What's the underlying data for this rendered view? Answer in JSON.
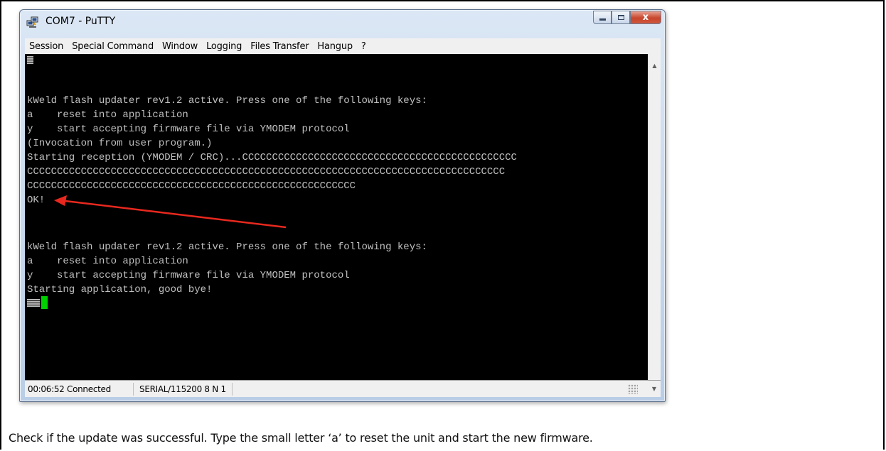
{
  "window": {
    "title": "COM7 - PuTTY",
    "controls": {
      "minimize_icon": "minimize-icon",
      "maximize_icon": "maximize-icon",
      "close_label": "x"
    }
  },
  "menubar": {
    "items": [
      "Session",
      "Special Command",
      "Window",
      "Logging",
      "Files Transfer",
      "Hangup",
      "?"
    ]
  },
  "terminal": {
    "lines": [
      "kWeld flash updater rev1.2 active. Press one of the following keys:",
      "a    reset into application",
      "y    start accepting firmware file via YMODEM protocol",
      "(Invocation from user program.)",
      "Starting reception (YMODEM / CRC)...CCCCCCCCCCCCCCCCCCCCCCCCCCCCCCCCCCCCCCCCCCCCCC",
      "CCCCCCCCCCCCCCCCCCCCCCCCCCCCCCCCCCCCCCCCCCCCCCCCCCCCCCCCCCCCCCCCCCCCCCCCCCCCCCCC",
      "CCCCCCCCCCCCCCCCCCCCCCCCCCCCCCCCCCCCCCCCCCCCCCCCCCCCCCC",
      "OK!",
      "kWeld flash updater rev1.2 active. Press one of the following keys:",
      "a    reset into application",
      "y    start accepting firmware file via YMODEM protocol",
      "Starting application, good bye!"
    ],
    "text_color": "#c0c0c0",
    "background": "#000000",
    "cursor_color": "#00d000"
  },
  "statusbar": {
    "connection": "00:06:52 Connected",
    "port": "SERIAL/115200 8 N 1"
  },
  "annotation": {
    "arrow_color": "#e8281e"
  },
  "caption": "Check if the update was successful. Type the small letter ‘a’ to reset the unit and start the new firmware."
}
